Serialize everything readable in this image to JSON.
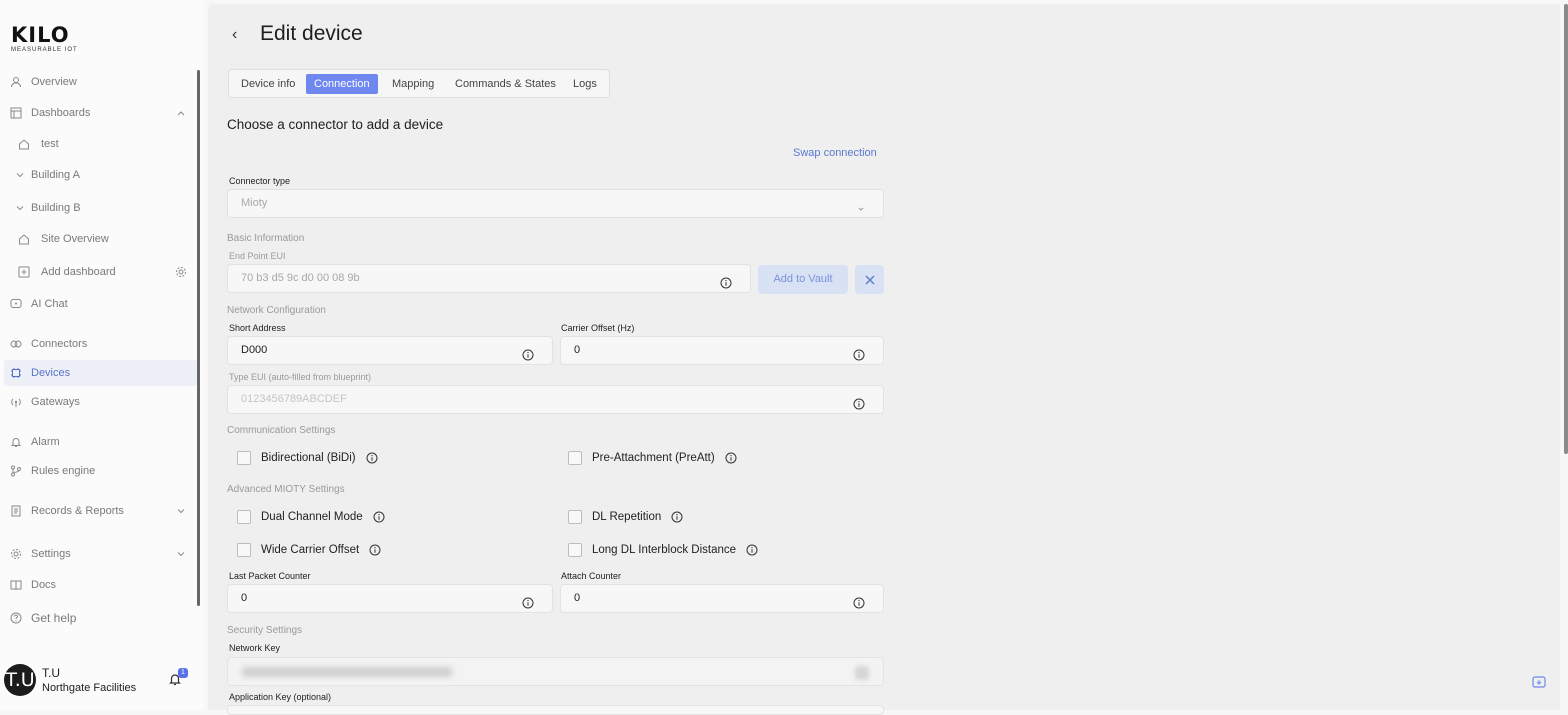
{
  "brand": {
    "logo_text": "KILO",
    "tagline": "MEASURABLE IOT"
  },
  "sidebar": {
    "items": [
      {
        "label": "Overview"
      },
      {
        "label": "Dashboards"
      },
      {
        "label": "test"
      },
      {
        "label": "Building A"
      },
      {
        "label": "Building B"
      },
      {
        "label": "Site Overview"
      },
      {
        "label": "Add dashboard"
      },
      {
        "label": "AI Chat"
      },
      {
        "label": "Connectors"
      },
      {
        "label": "Devices"
      },
      {
        "label": "Gateways"
      },
      {
        "label": "Alarm"
      },
      {
        "label": "Rules engine"
      },
      {
        "label": "Records & Reports"
      },
      {
        "label": "Settings"
      },
      {
        "label": "Docs"
      },
      {
        "label": "Get help"
      }
    ],
    "active_item": "Devices"
  },
  "user": {
    "initials": "T.U",
    "name": "T.U",
    "org": "Northgate Facilities",
    "notifications": "1"
  },
  "page": {
    "title": "Edit device",
    "accent_color": "#6e88f0"
  },
  "tabs": [
    {
      "label": "Device info"
    },
    {
      "label": "Connection"
    },
    {
      "label": "Mapping"
    },
    {
      "label": "Commands & States"
    },
    {
      "label": "Logs"
    }
  ],
  "active_tab": "Connection",
  "form": {
    "heading": "Choose a connector to add a device",
    "swap_link": "Swap connection",
    "connector_type_label": "Connector type",
    "connector_type_value": "Mioty",
    "basic_info_group": "Basic Information",
    "eui_label": "End Point EUI",
    "eui_value": "70 b3 d5 9c d0 00 08 9b",
    "add_vault_label": "Add to Vault",
    "network_group": "Network Configuration",
    "short_address_label": "Short Address",
    "short_address_value": "D000",
    "carrier_offset_label": "Carrier Offset (Hz)",
    "carrier_offset_value": "0",
    "type_eui_label": "Type EUI (auto-filled from blueprint)",
    "type_eui_placeholder": "0123456789ABCDEF",
    "comm_group": "Communication Settings",
    "bidi_label": "Bidirectional (BiDi)",
    "preatt_label": "Pre-Attachment (PreAtt)",
    "advanced_group": "Advanced MIOTY Settings",
    "dual_channel_label": "Dual Channel Mode",
    "dl_repetition_label": "DL Repetition",
    "wide_carrier_label": "Wide Carrier Offset",
    "long_dl_label": "Long DL Interblock Distance",
    "last_packet_label": "Last Packet Counter",
    "last_packet_value": "0",
    "attach_counter_label": "Attach Counter",
    "attach_counter_value": "0",
    "security_group": "Security Settings",
    "network_key_label": "Network Key",
    "app_key_label": "Application Key (optional)"
  }
}
